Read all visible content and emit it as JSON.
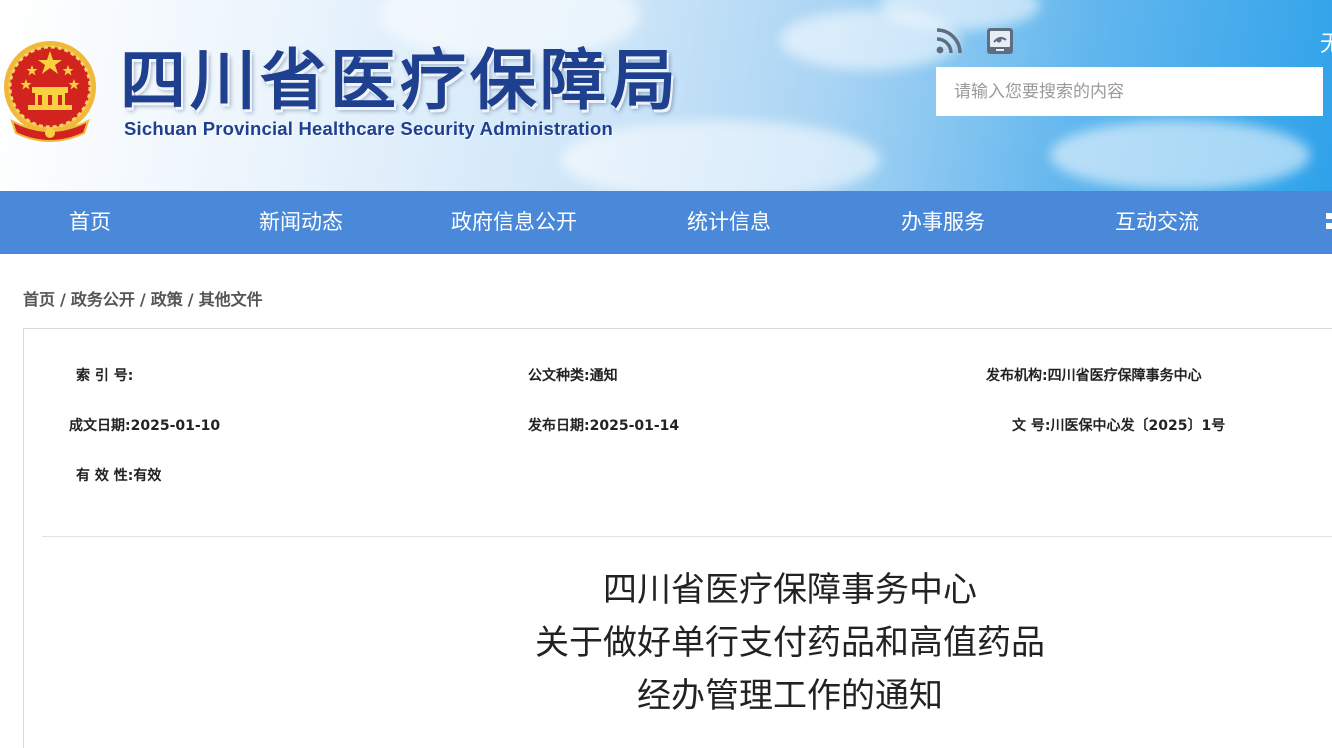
{
  "header": {
    "title_cn": "四川省医疗保障局",
    "title_en": "Sichuan Provincial Healthcare Security Administration",
    "rss_icon": "rss-icon",
    "weibo_icon": "weibo-icon",
    "edge_char": "无",
    "search": {
      "placeholder": "请输入您要搜索的内容"
    },
    "colors": {
      "title": "#1f3f8f",
      "nav": "#4a88d9"
    }
  },
  "nav": {
    "items": [
      "首页",
      "新闻动态",
      "政府信息公开",
      "统计信息",
      "办事服务",
      "互动交流"
    ]
  },
  "breadcrumb": {
    "items": [
      "首页",
      "政务公开",
      "政策",
      "其他文件"
    ],
    "separator": "/"
  },
  "meta": {
    "index_label": "索 引 号:",
    "index_value": "",
    "doc_type_label": "公文种类:",
    "doc_type_value": "通知",
    "publisher_label": "发布机构:",
    "publisher_value": "四川省医疗保障事务中心",
    "written_date_label": "成文日期:",
    "written_date_value": "2025-01-10",
    "publish_date_label": "发布日期:",
    "publish_date_value": "2025-01-14",
    "doc_no_label": "文 号:",
    "doc_no_value": "川医保中心发〔2025〕1号",
    "validity_label": "有 效 性:",
    "validity_value": "有效"
  },
  "document": {
    "title_lines": [
      "四川省医疗保障事务中心",
      "关于做好单行支付药品和高值药品",
      "经办管理工作的通知"
    ]
  }
}
